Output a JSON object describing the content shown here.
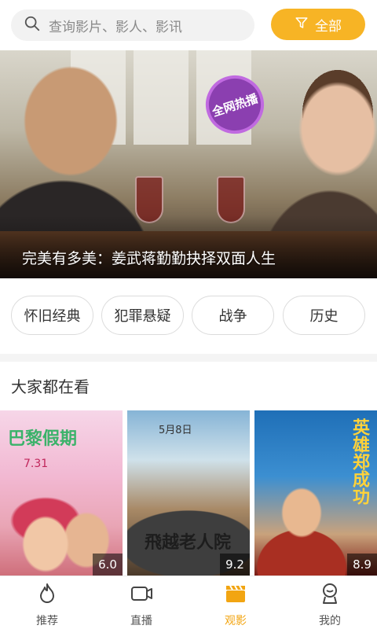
{
  "search": {
    "placeholder": "查询影片、影人、影讯"
  },
  "filter": {
    "label": "全部"
  },
  "banner": {
    "stamp": "全网热播",
    "caption": "完美有多美：姜武蒋勤勤抉择双面人生"
  },
  "categories": [
    "怀旧经典",
    "犯罪悬疑",
    "战争",
    "历史"
  ],
  "section": {
    "title": "大家都在看"
  },
  "posters": [
    {
      "title": "巴黎假期",
      "date": "7.31",
      "score": "6.0"
    },
    {
      "title": "飛越老人院",
      "date": "5月8日",
      "score": "9.2"
    },
    {
      "title": "英雄郑成功",
      "score": "8.9"
    }
  ],
  "nav": [
    {
      "label": "推荐",
      "icon": "flame-icon",
      "active": false
    },
    {
      "label": "直播",
      "icon": "camera-icon",
      "active": false
    },
    {
      "label": "观影",
      "icon": "clapperboard-icon",
      "active": true
    },
    {
      "label": "我的",
      "icon": "profile-icon",
      "active": false
    }
  ],
  "colors": {
    "accent": "#f7b425",
    "nav_active": "#f2a512"
  }
}
